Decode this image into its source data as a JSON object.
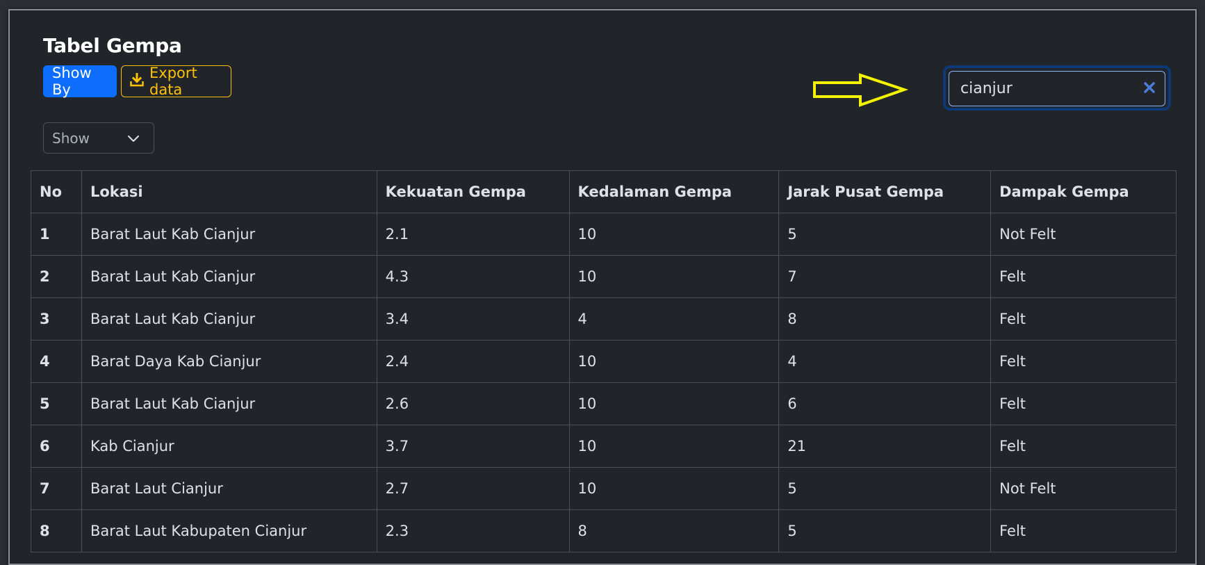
{
  "page": {
    "title": "Tabel Gempa"
  },
  "toolbar": {
    "show_by_label": "Show By",
    "export_label": "Export data",
    "select_value": "Show"
  },
  "search": {
    "value": "cianjur"
  },
  "colors": {
    "background": "#212529",
    "primary": "#0d6efd",
    "warning": "#ffc107",
    "annotation_arrow": "#f5f200"
  },
  "icons": {
    "export": "download-icon",
    "select": "chevron-down-icon",
    "clear": "close-icon",
    "annotation": "arrow-right-icon"
  },
  "table": {
    "headers": [
      "No",
      "Lokasi",
      "Kekuatan Gempa",
      "Kedalaman Gempa",
      "Jarak Pusat Gempa",
      "Dampak Gempa"
    ],
    "rows": [
      [
        "1",
        "Barat Laut Kab Cianjur",
        "2.1",
        "10",
        "5",
        "Not Felt"
      ],
      [
        "2",
        "Barat Laut Kab Cianjur",
        "4.3",
        "10",
        "7",
        "Felt"
      ],
      [
        "3",
        "Barat Laut Kab Cianjur",
        "3.4",
        "4",
        "8",
        "Felt"
      ],
      [
        "4",
        "Barat Daya Kab Cianjur",
        "2.4",
        "10",
        "4",
        "Felt"
      ],
      [
        "5",
        "Barat Laut Kab Cianjur",
        "2.6",
        "10",
        "6",
        "Felt"
      ],
      [
        "6",
        "Kab Cianjur",
        "3.7",
        "10",
        "21",
        "Felt"
      ],
      [
        "7",
        "Barat Laut Cianjur",
        "2.7",
        "10",
        "5",
        "Not Felt"
      ],
      [
        "8",
        "Barat Laut Kabupaten Cianjur",
        "2.3",
        "8",
        "5",
        "Felt"
      ]
    ]
  }
}
